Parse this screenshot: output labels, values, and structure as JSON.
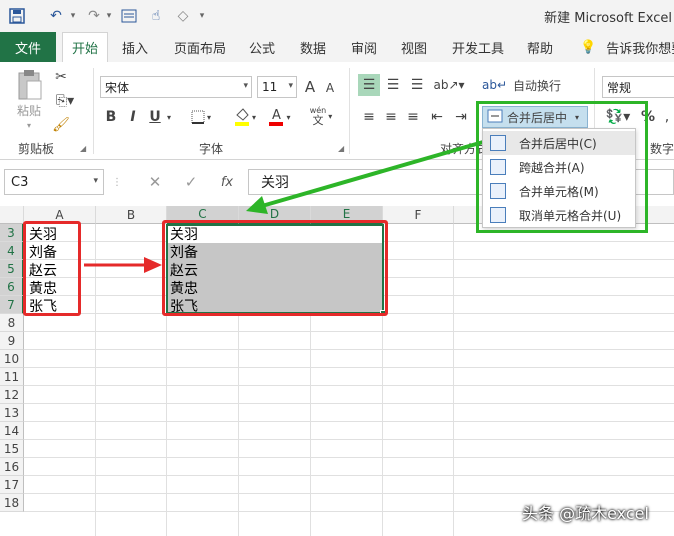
{
  "window": {
    "title": "新建 Microsoft Excel"
  },
  "tabs": {
    "file": "文件",
    "items": [
      "开始",
      "插入",
      "页面布局",
      "公式",
      "数据",
      "审阅",
      "视图",
      "开发工具",
      "帮助"
    ],
    "tell_me": "告诉我你想要"
  },
  "ribbon": {
    "clipboard": {
      "paste": "粘贴",
      "label": "剪贴板"
    },
    "font": {
      "name": "宋体",
      "size": "11",
      "label": "字体",
      "bold": "B",
      "italic": "I",
      "underline": "U",
      "grow": "A",
      "shrink": "A",
      "wen": "wén",
      "font_color": "A"
    },
    "alignment": {
      "wrap": "自动换行",
      "merge_center": "合并后居中",
      "label": "对齐方式"
    },
    "number": {
      "format": "常规",
      "percent": "%",
      "label": "数字"
    }
  },
  "merge_menu": {
    "items": [
      {
        "label": "合并后居中(C)"
      },
      {
        "label": "跨越合并(A)"
      },
      {
        "label": "合并单元格(M)"
      },
      {
        "label": "取消单元格合并(U)"
      }
    ]
  },
  "formula_bar": {
    "name_box": "C3",
    "fx": "fx",
    "cancel": "✕",
    "enter": "✓",
    "value": "关羽"
  },
  "sheet": {
    "columns": [
      "A",
      "B",
      "C",
      "D",
      "E",
      "F"
    ],
    "rows": [
      "3",
      "4",
      "5",
      "6",
      "7",
      "8",
      "9",
      "10",
      "11",
      "12",
      "13",
      "14",
      "15",
      "16",
      "17",
      "18"
    ],
    "colA": [
      "关羽",
      "刘备",
      "赵云",
      "黄忠",
      "张飞"
    ],
    "colC": [
      "关羽",
      "刘备",
      "赵云",
      "黄忠",
      "张飞"
    ]
  },
  "watermark": "头条 @疏木excel",
  "colors": {
    "excel_green": "#217346",
    "highlight_red": "#e52a2a",
    "highlight_green": "#2db528"
  }
}
